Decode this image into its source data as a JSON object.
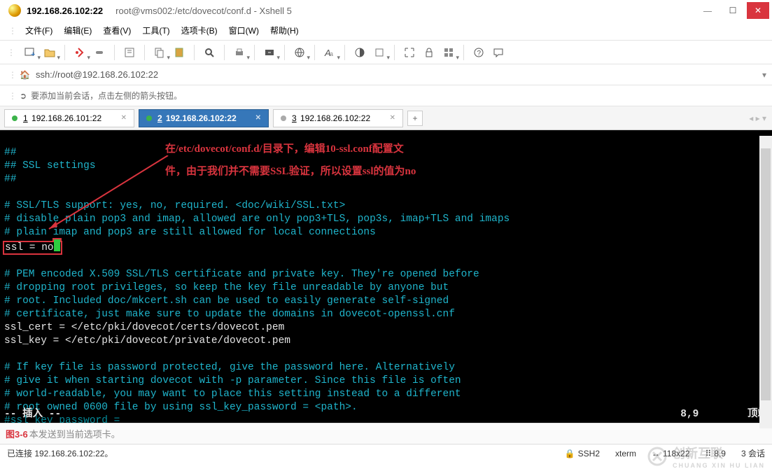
{
  "window": {
    "title_main": "192.168.26.102:22",
    "title_path": "root@vms002:/etc/dovecot/conf.d - Xshell 5"
  },
  "menu": {
    "file": "文件(F)",
    "edit": "编辑(E)",
    "view": "查看(V)",
    "tools": "工具(T)",
    "tabs": "选项卡(B)",
    "window": "窗口(W)",
    "help": "帮助(H)"
  },
  "address": {
    "url": "ssh://root@192.168.26.102:22"
  },
  "hint": {
    "text": "要添加当前会话，点击左侧的箭头按钮。"
  },
  "tabs": [
    {
      "num": "1",
      "label": " 192.168.26.101:22",
      "active": false,
      "dot": "green"
    },
    {
      "num": "2",
      "label": " 192.168.26.102:22",
      "active": true,
      "dot": "green"
    },
    {
      "num": "3",
      "label": " 192.168.26.102:22",
      "active": false,
      "dot": "gray"
    }
  ],
  "annotation": {
    "line1": "在/etc/dovecot/conf.d/目录下，编辑10-ssl.conf配置文",
    "line2": "件，由于我们并不需要SSL验证，所以设置ssl的值为no"
  },
  "terminal": {
    "l1": "##",
    "l2": "## SSL settings",
    "l3": "##",
    "l4": "",
    "l5": "# SSL/TLS support: yes, no, required. <doc/wiki/SSL.txt>",
    "l6": "# disable plain pop3 and imap, allowed are only pop3+TLS, pop3s, imap+TLS and imaps",
    "l7": "# plain imap and pop3 are still allowed for local connections",
    "l8": "ssl = no",
    "l9": "",
    "l10": "# PEM encoded X.509 SSL/TLS certificate and private key. They're opened before",
    "l11": "# dropping root privileges, so keep the key file unreadable by anyone but",
    "l12": "# root. Included doc/mkcert.sh can be used to easily generate self-signed",
    "l13": "# certificate, just make sure to update the domains in dovecot-openssl.cnf",
    "l14": "ssl_cert = </etc/pki/dovecot/certs/dovecot.pem",
    "l15": "ssl_key = </etc/pki/dovecot/private/dovecot.pem",
    "l16": "",
    "l17": "# If key file is password protected, give the password here. Alternatively",
    "l18": "# give it when starting dovecot with -p parameter. Since this file is often",
    "l19": "# world-readable, you may want to place this setting instead to a different",
    "l20": "# root owned 0600 file by using ssl_key_password = <path>.",
    "l21": "#ssl_key_password =",
    "mode": "-- 插入 --",
    "cursor_pos": "8,9",
    "scroll_pos": "顶端"
  },
  "input": {
    "figure": "图3-6",
    "placeholder": "本发送到当前选项卡。"
  },
  "status": {
    "connected": "已连接 192.168.26.102:22。",
    "proto": "SSH2",
    "term": "xterm",
    "size": "118x22",
    "pos": "8,9",
    "sessions": "3 会话"
  },
  "watermark": {
    "brand": "创新互联",
    "sub": "CHUANG XIN HU LIAN"
  }
}
